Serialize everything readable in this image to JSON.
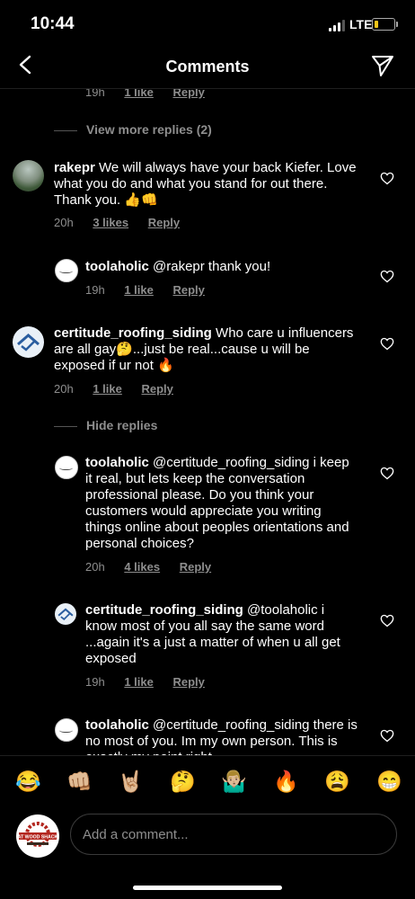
{
  "status_bar": {
    "time": "10:44",
    "network": "LTE"
  },
  "header": {
    "title": "Comments"
  },
  "top_partial": {
    "time": "19h",
    "likes": "1 like",
    "reply": "Reply"
  },
  "view_more": {
    "label": "View more replies (2)"
  },
  "comments": [
    {
      "username": "rakepr",
      "text": "We will always have your back Kiefer. Love what you do and what you stand for out there.  Thank you. 👍👊",
      "time": "20h",
      "likes": "3 likes",
      "reply": "Reply"
    },
    {
      "username": "toolaholic",
      "text": "@rakepr thank you!",
      "time": "19h",
      "likes": "1 like",
      "reply": "Reply"
    },
    {
      "username": "certitude_roofing_siding",
      "text": "Who care u influencers are all gay🤔...just be real...cause u will be exposed if ur not 🔥",
      "time": "20h",
      "likes": "1 like",
      "reply": "Reply"
    },
    {
      "username": "toolaholic",
      "text": "@certitude_roofing_siding i keep it real, but lets keep the conversation professional please. Do you think your customers would appreciate you writing things online about peoples orientations and personal choices?",
      "time": "20h",
      "likes": "4 likes",
      "reply": "Reply"
    },
    {
      "username": "certitude_roofing_siding",
      "text": "@toolaholic i know most of you all say the same word ...again it's a just a matter of when u all get exposed",
      "time": "19h",
      "likes": "1 like",
      "reply": "Reply"
    },
    {
      "username": "toolaholic",
      "text": "@certitude_roofing_siding there is no most of you. Im my own person. This is exactly my point right"
    }
  ],
  "hide_replies": {
    "label": "Hide replies"
  },
  "emoji_bar": [
    "😂",
    "👊🏼",
    "🤘🏼",
    "🤔",
    "🤷🏼‍♂️",
    "🔥",
    "😩",
    "😁"
  ],
  "composer": {
    "placeholder": "Add a comment...",
    "avatar_text": "AT WOOD SHACK"
  },
  "colors": {
    "background": "#000000",
    "muted_text": "#8e8e8e",
    "battery": "#f5c518"
  },
  "icons": [
    "back-arrow-icon",
    "send-icon",
    "heart-icon",
    "signal-icon",
    "battery-icon"
  ]
}
